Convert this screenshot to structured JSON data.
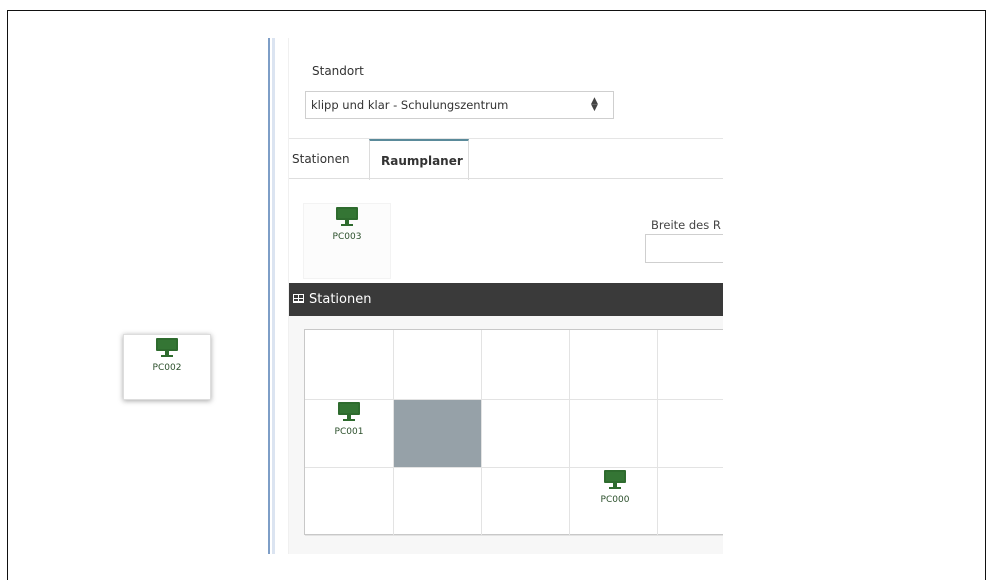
{
  "standort": {
    "label": "Standort",
    "selected": "klipp und klar - Schulungszentrum",
    "caret": "▲▼"
  },
  "tabs": [
    {
      "label": "Stationen",
      "active": false
    },
    {
      "label": "Raumplaner",
      "active": true
    }
  ],
  "palette": {
    "stations": [
      {
        "label": "PC003"
      }
    ]
  },
  "breite": {
    "label": "Breite des R",
    "value": ""
  },
  "section": {
    "title": "Stationen"
  },
  "grid_stations": {
    "pc001": "PC001",
    "pc002": "PC002",
    "pc000": "PC000"
  },
  "colors": {
    "monitor_green": "#2e6b2e",
    "section_bar": "#3a3a3a",
    "highlight_cell": "#96a1a8",
    "tab_accent": "#5a8a9a"
  },
  "icons": {
    "station": "monitor-icon",
    "section": "table-grid-icon",
    "select": "sort-caret-icon"
  }
}
